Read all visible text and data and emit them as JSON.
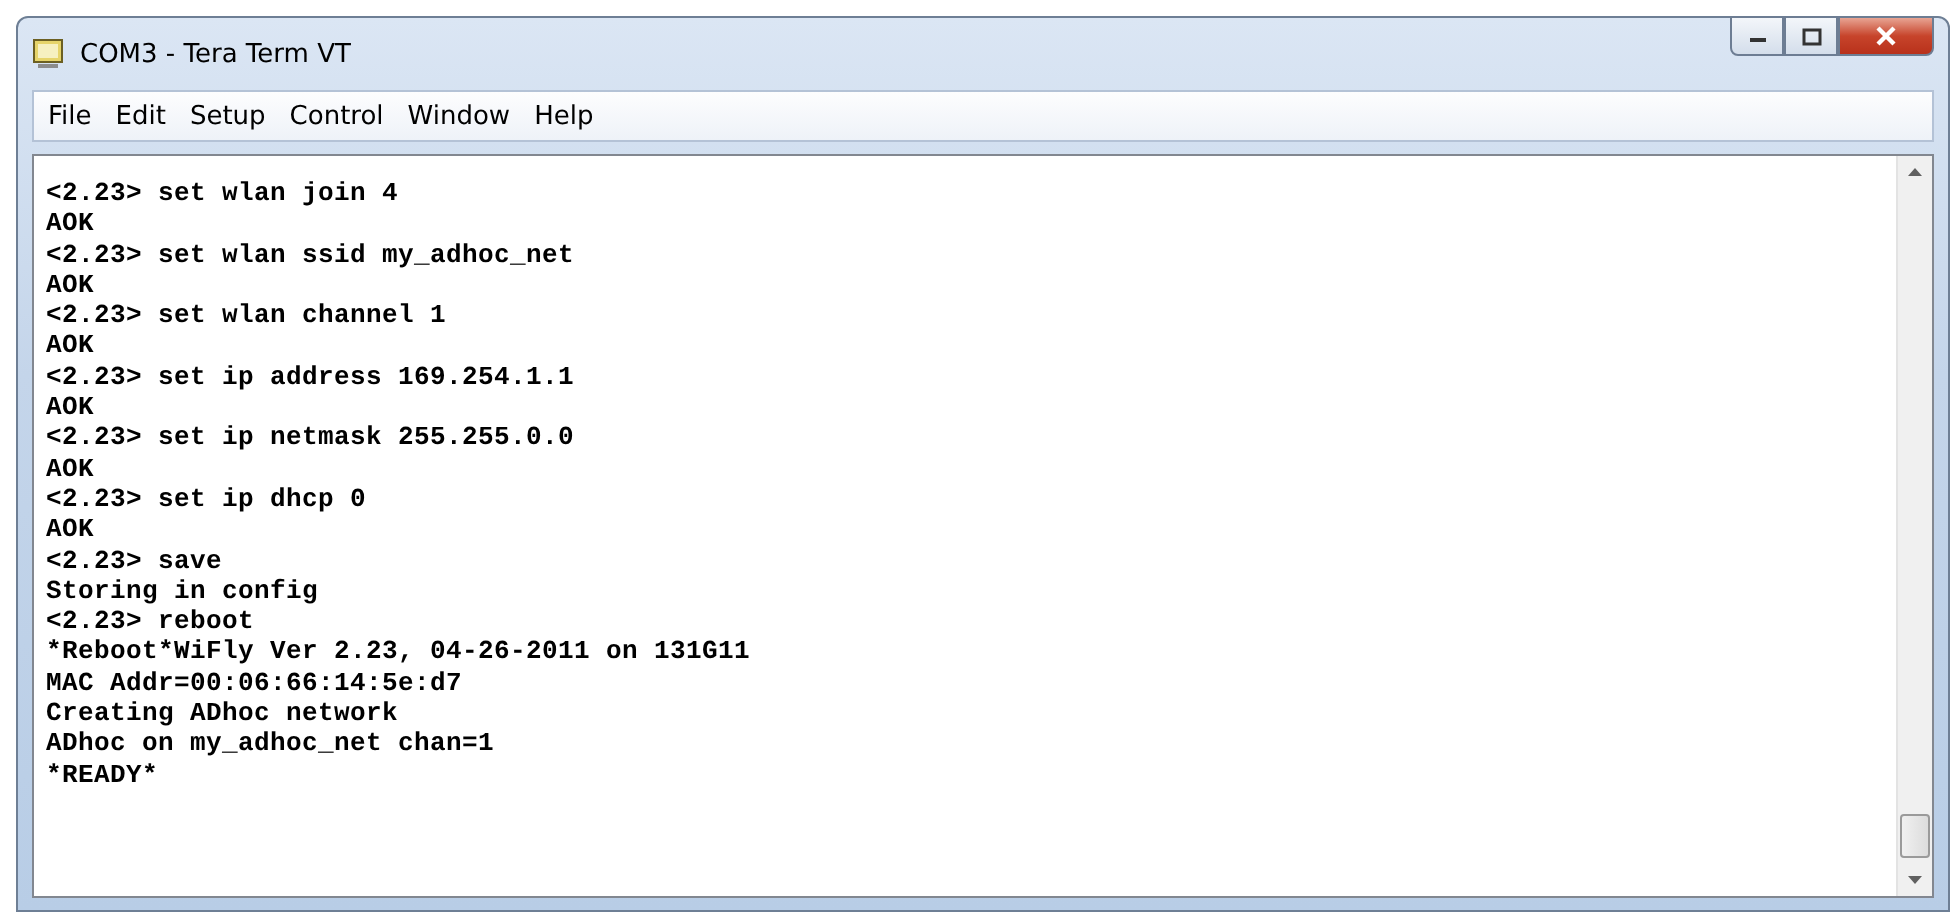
{
  "window": {
    "title": "COM3 - Tera Term VT"
  },
  "menu": [
    "File",
    "Edit",
    "Setup",
    "Control",
    "Window",
    "Help"
  ],
  "terminal": {
    "lines": [
      "<2.23> set wlan join 4",
      "AOK",
      "<2.23> set wlan ssid my_adhoc_net",
      "AOK",
      "<2.23> set wlan channel 1",
      "AOK",
      "<2.23> set ip address 169.254.1.1",
      "AOK",
      "<2.23> set ip netmask 255.255.0.0",
      "AOK",
      "<2.23> set ip dhcp 0",
      "AOK",
      "<2.23> save",
      "Storing in config",
      "<2.23> reboot",
      "*Reboot*WiFly Ver 2.23, 04-26-2011 on 131G11",
      "MAC Addr=00:06:66:14:5e:d7",
      "Creating ADhoc network",
      "ADhoc on my_adhoc_net chan=1",
      "*READY*"
    ]
  }
}
